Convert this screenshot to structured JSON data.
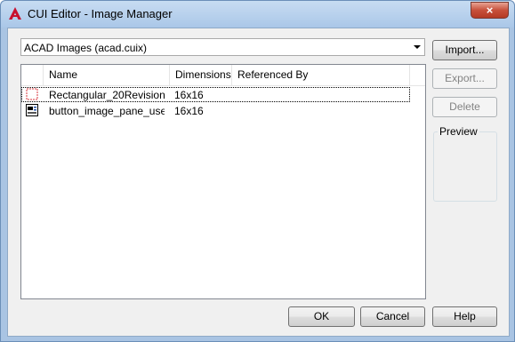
{
  "window": {
    "title": "CUI Editor - Image Manager",
    "close_label": "×"
  },
  "source": {
    "selected": "ACAD Images (acad.cuix)"
  },
  "list": {
    "columns": [
      "Name",
      "Dimensions",
      "Referenced By"
    ],
    "rows": [
      {
        "name": "Rectangular_20Revision...",
        "dimensions": "16x16",
        "referenced_by": "",
        "icon": "revision-cloud-icon"
      },
      {
        "name": "button_image_pane_use...",
        "dimensions": "16x16",
        "referenced_by": "",
        "icon": "image-pane-icon"
      }
    ]
  },
  "buttons": {
    "import": "Import...",
    "export": "Export...",
    "delete": "Delete",
    "ok": "OK",
    "cancel": "Cancel",
    "help": "Help"
  },
  "preview": {
    "label": "Preview"
  },
  "colors": {
    "title_bar": "#aac7e8",
    "client_bg": "#f0f0f0",
    "close_button": "#c7503b"
  }
}
